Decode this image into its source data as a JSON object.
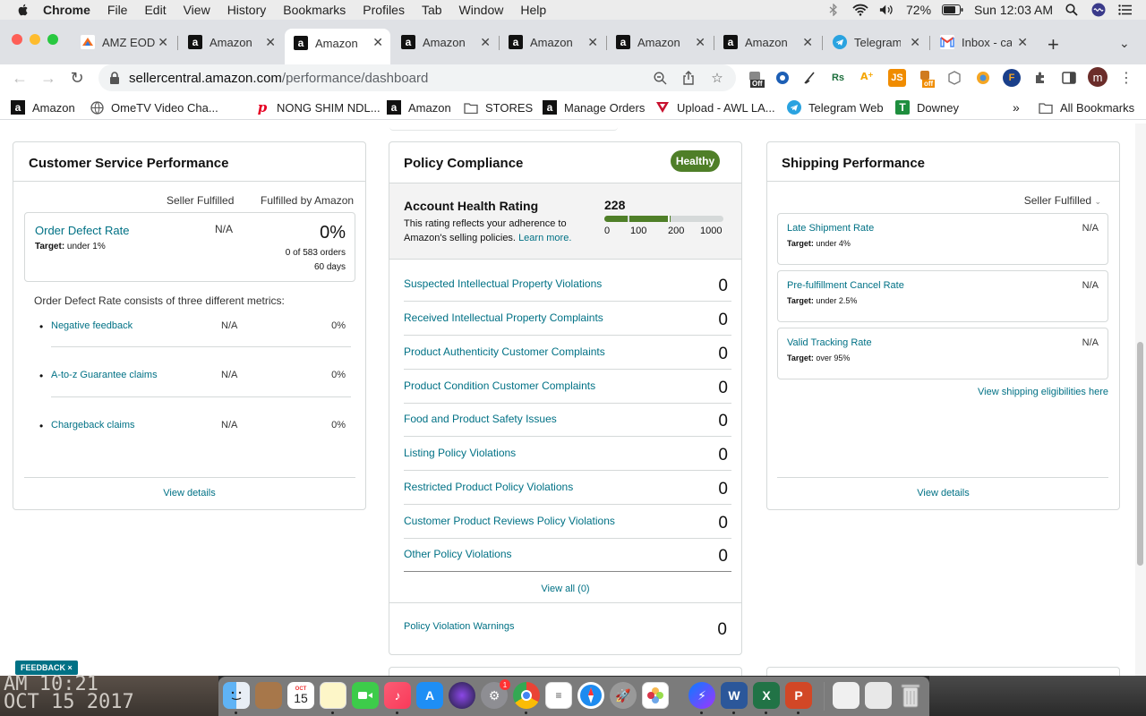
{
  "menubar": {
    "app": "Chrome",
    "items": [
      "File",
      "Edit",
      "View",
      "History",
      "Bookmarks",
      "Profiles",
      "Tab",
      "Window",
      "Help"
    ],
    "battery": "72%",
    "clock": "Sun 12:03 AM"
  },
  "tabs": [
    {
      "title": "AMZ EOD",
      "icon": "amz-eod-icon"
    },
    {
      "title": "Amazon",
      "icon": "amazon-icon"
    },
    {
      "title": "Amazon",
      "icon": "amazon-icon",
      "active": true
    },
    {
      "title": "Amazon",
      "icon": "amazon-icon"
    },
    {
      "title": "Amazon",
      "icon": "amazon-icon"
    },
    {
      "title": "Amazon",
      "icon": "amazon-icon"
    },
    {
      "title": "Amazon",
      "icon": "amazon-icon"
    },
    {
      "title": "Telegram",
      "icon": "telegram-icon"
    },
    {
      "title": "Inbox - ca",
      "icon": "gmail-icon"
    }
  ],
  "address": {
    "host": "sellercentral.amazon.com",
    "path": "/performance/dashboard"
  },
  "extensions": {
    "off1": "Off",
    "rs": "Rs",
    "js": "JS",
    "off2": "off",
    "f": "F",
    "profile_initial": "m"
  },
  "bookmarks": [
    {
      "label": "Amazon",
      "icon": "amazon-icon"
    },
    {
      "label": "OmeTV Video Cha...",
      "icon": "globe-icon"
    },
    {
      "label": "NONG SHIM NDL...",
      "icon": "pinterest-icon"
    },
    {
      "label": "Amazon",
      "icon": "amazon-icon"
    },
    {
      "label": "STORES",
      "icon": "folder-icon"
    },
    {
      "label": "Manage Orders",
      "icon": "amazon-icon"
    },
    {
      "label": "Upload - AWL LA...",
      "icon": "awl-icon"
    },
    {
      "label": "Telegram Web",
      "icon": "telegram-icon"
    },
    {
      "label": "Downey",
      "icon": "bookmark-green-icon"
    }
  ],
  "bookmarks_overflow": "»",
  "all_bookmarks": "All Bookmarks",
  "customer_service": {
    "title": "Customer Service Performance",
    "col_seller": "Seller Fulfilled",
    "col_fba": "Fulfilled by Amazon",
    "odr_label": "Order Defect Rate",
    "odr_target_prefix": "Target:",
    "odr_target": " under 1%",
    "odr_seller": "N/A",
    "odr_fba": "0%",
    "odr_orders": "0 of 583 orders",
    "odr_days": "60 days",
    "consists": "Order Defect Rate consists of three different metrics:",
    "metrics": [
      {
        "label": "Negative feedback",
        "seller": "N/A",
        "fba": "0%"
      },
      {
        "label": "A-to-z Guarantee claims",
        "seller": "N/A",
        "fba": "0%"
      },
      {
        "label": "Chargeback claims",
        "seller": "N/A",
        "fba": "0%"
      }
    ],
    "view_details": "View details"
  },
  "policy": {
    "title": "Policy Compliance",
    "status": "Healthy",
    "ahr_title": "Account Health Rating",
    "ahr_desc_1": "This rating reflects your adherence to",
    "ahr_desc_2": "Amazon's selling policies.",
    "learn_more": "Learn more.",
    "ahr_score": "228",
    "ahr_fraction": 0.228,
    "ticks": [
      "0",
      "100",
      "200",
      "1000"
    ],
    "rows": [
      {
        "label": "Suspected Intellectual Property Violations",
        "value": "0"
      },
      {
        "label": "Received Intellectual Property Complaints",
        "value": "0"
      },
      {
        "label": "Product Authenticity Customer Complaints",
        "value": "0"
      },
      {
        "label": "Product Condition Customer Complaints",
        "value": "0"
      },
      {
        "label": "Food and Product Safety Issues",
        "value": "0"
      },
      {
        "label": "Listing Policy Violations",
        "value": "0"
      },
      {
        "label": "Restricted Product Policy Violations",
        "value": "0"
      },
      {
        "label": "Customer Product Reviews Policy Violations",
        "value": "0"
      },
      {
        "label": "Other Policy Violations",
        "value": "0"
      }
    ],
    "view_all": "View all (0)",
    "warnings_label": "Policy Violation Warnings",
    "warnings_value": "0"
  },
  "shipping": {
    "title": "Shipping Performance",
    "dropdown": "Seller Fulfilled",
    "metrics": [
      {
        "label": "Late Shipment Rate",
        "target_prefix": "Target:",
        "target": " under 4%",
        "value": "N/A"
      },
      {
        "label": "Pre-fulfillment Cancel Rate",
        "target_prefix": "Target:",
        "target": " under 2.5%",
        "value": "N/A"
      },
      {
        "label": "Valid Tracking Rate",
        "target_prefix": "Target:",
        "target": " over 95%",
        "value": "N/A"
      }
    ],
    "eligibilities": "View shipping eligibilities here",
    "view_details": "View details"
  },
  "feedback": "FEEDBACK ×",
  "wallpaper": {
    "line1": "AM 10:21",
    "line2": "OCT 15 2017"
  },
  "dock": {
    "calendar_month": "OCT",
    "calendar_day": "15",
    "settings_badge": "1"
  },
  "colors": {
    "link": "#007185",
    "healthy": "#4f7f28",
    "border": "#d5d9d9"
  }
}
